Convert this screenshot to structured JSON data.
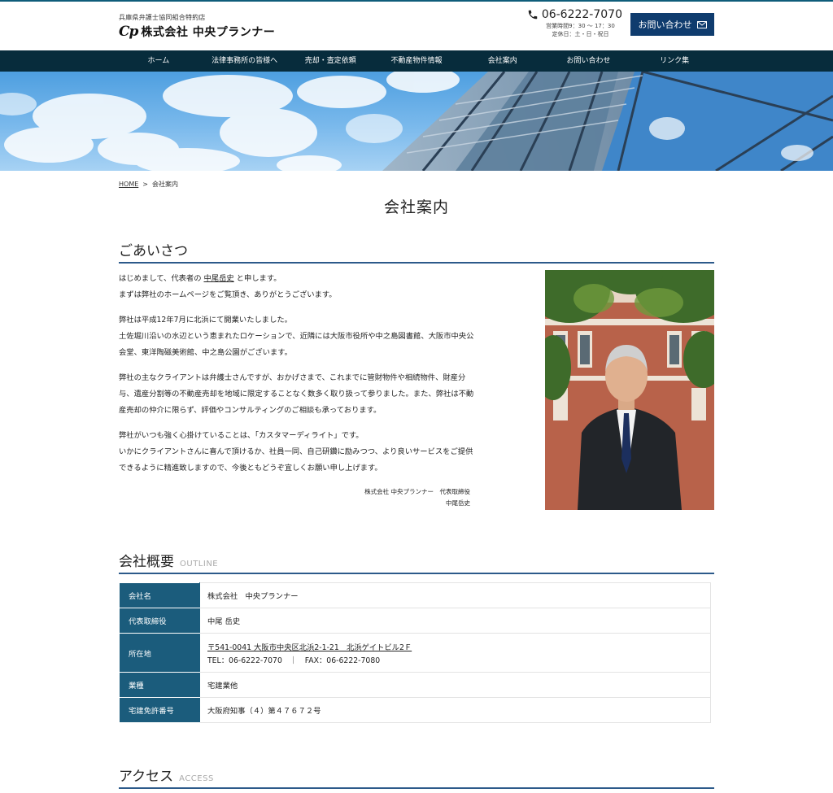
{
  "header": {
    "tagline": "兵庫県弁護士協同組合特約店",
    "logo_mark": "Cp",
    "company_name": "株式会社 中央プランナー",
    "phone": "06-6222-7070",
    "hours": "営業時間9：30 ～ 17：30",
    "holidays": "定休日：土・日・祝日",
    "contact_button": "お問い合わせ"
  },
  "nav": {
    "items": [
      "ホーム",
      "法律事務所の皆様へ",
      "売却・査定依頼",
      "不動産物件情報",
      "会社案内",
      "お問い合わせ",
      "リンク集"
    ]
  },
  "breadcrumb": {
    "home": "HOME",
    "separator": ">",
    "current": "会社案内"
  },
  "page_title": "会社案内",
  "greeting": {
    "heading": "ごあいさつ",
    "p1_before": "はじめまして、代表者の ",
    "p1_name": "中尾岳史",
    "p1_after": " と申します。\nまずは弊社のホームページをご覧頂き、ありがとうございます。",
    "p2": "弊社は平成12年7月に北浜にて開業いたしました。\n土佐堀川沿いの水辺という恵まれたロケーションで、近隣には大阪市役所や中之島図書館、大阪市中央公会堂、東洋陶磁美術館、中之島公園がございます。",
    "p3": "弊社の主なクライアントは弁護士さんですが、おかげさまで、これまでに管財物件や相続物件、財産分与、遺産分割等の不動産売却を地域に限定することなく数多く取り扱って参りました。また、弊社は不動産売却の仲介に限らず、評価やコンサルティングのご相談も承っております。",
    "p4": "弊社がいつも強く心掛けていることは、「カスタマーディライト」です。\nいかにクライアントさんに喜んで頂けるか、社員一同、自己研鑽に励みつつ、より良いサービスをご提供できるように精進致しますので、今後ともどうぞ宜しくお願い申し上げます。",
    "signature_line1": "株式会社 中央プランナー　代表取締役",
    "signature_line2": "中尾岳史"
  },
  "outline": {
    "heading": "会社概要",
    "heading_en": "OUTLINE",
    "rows": [
      {
        "label": "会社名",
        "value": "株式会社　中央プランナー"
      },
      {
        "label": "代表取締役",
        "value": "中尾 岳史"
      },
      {
        "label": "所在地",
        "value": "〒541-0041 大阪市中央区北浜2-1-21　北浜ゲイトビル2Ｆ",
        "value2": "TEL：06-6222-7070　｜　FAX：06-6222-7080"
      },
      {
        "label": "業種",
        "value": "宅建業他"
      },
      {
        "label": "宅建免許番号",
        "value": "大阪府知事（４）第４７６７２号"
      }
    ]
  },
  "access": {
    "heading": "アクセス",
    "heading_en": "ACCESS"
  },
  "colors": {
    "nav_bg": "#072c3c",
    "accent": "#0f3c6e",
    "table_header": "#1b5c7c",
    "heading_rule": "#2c5a8a"
  },
  "icons": [
    "phone-icon",
    "mail-icon"
  ]
}
